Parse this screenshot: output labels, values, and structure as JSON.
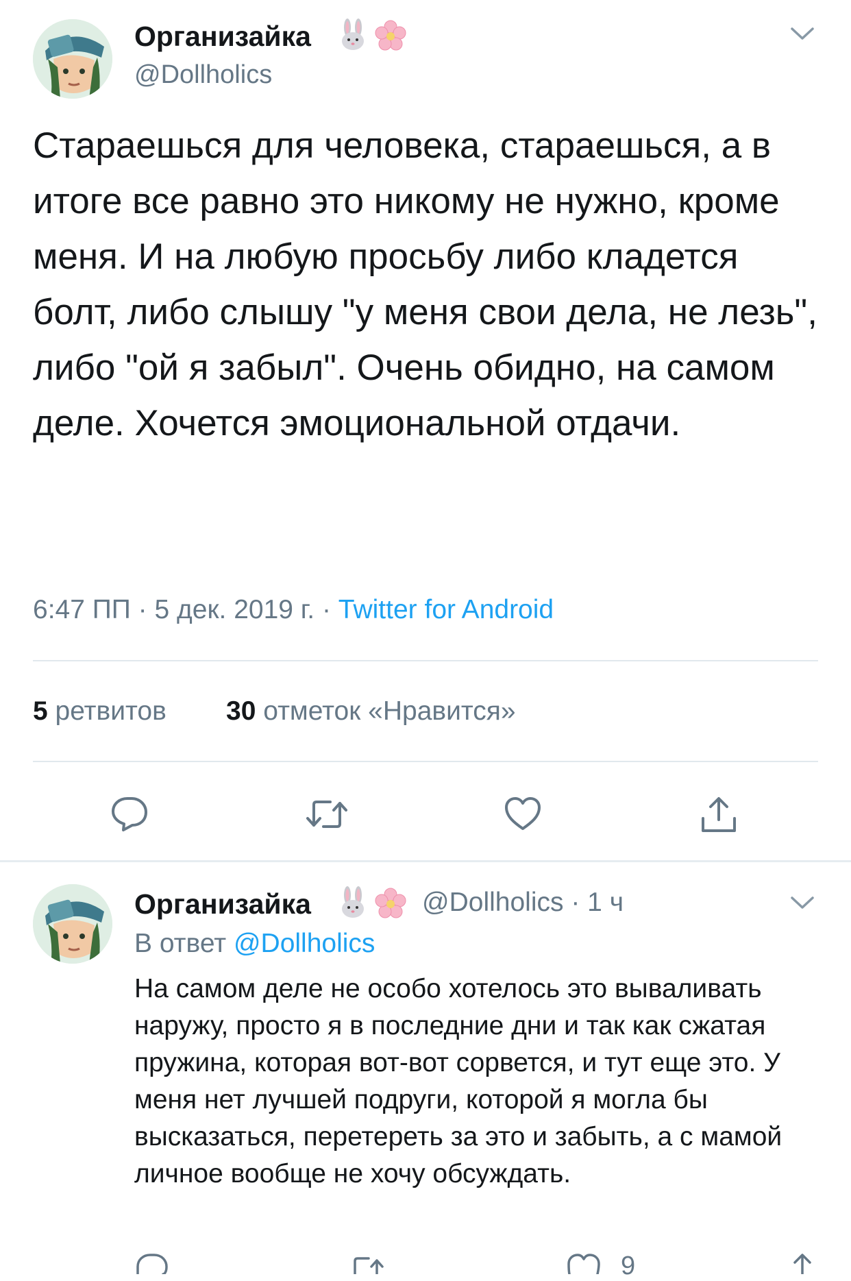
{
  "tweet": {
    "author_name": "Организайка",
    "author_handle": "@Dollholics",
    "emojis": [
      "rabbit-emoji",
      "cherry-blossom-emoji"
    ],
    "text": "Стараешься для человека, стараешься, а в итоге все равно это никому не нужно, кроме меня. И на любую просьбу либо кладется болт, либо слышу \"у меня свои дела, не лезь\", либо \"ой я забыл\". Очень обидно, на самом деле. Хочется эмоциональной отдачи.",
    "time": "6:47 ПП",
    "date": "5 дек. 2019 г.",
    "separator": "·",
    "source": "Twitter for Android",
    "retweets_count": "5",
    "retweets_label": "ретвитов",
    "likes_count": "30",
    "likes_label": "отметок «Нравится»"
  },
  "reply": {
    "author_name": "Организайка",
    "author_handle": "@Dollholics",
    "age": "1 ч",
    "separator": "·",
    "reply_prefix": "В ответ",
    "reply_to": "@Dollholics",
    "text": "На самом деле не особо хотелось это вываливать наружу, просто я в последние дни и так как сжатая пружина, которая вот-вот сорвется, и тут еще это. У меня нет лучшей подруги, которой я могла бы высказаться, перетереть за это и забыть, а с мамой личное вообще не хочу обсуждать.",
    "likes_count": "9"
  },
  "icons": {
    "reply": "comment-icon",
    "retweet": "retweet-icon",
    "like": "heart-icon",
    "share": "share-icon",
    "more": "chevron-down-icon"
  },
  "colors": {
    "text": "#14171a",
    "secondary": "#657786",
    "link": "#1da1f2",
    "divider": "#e1e8ed"
  }
}
